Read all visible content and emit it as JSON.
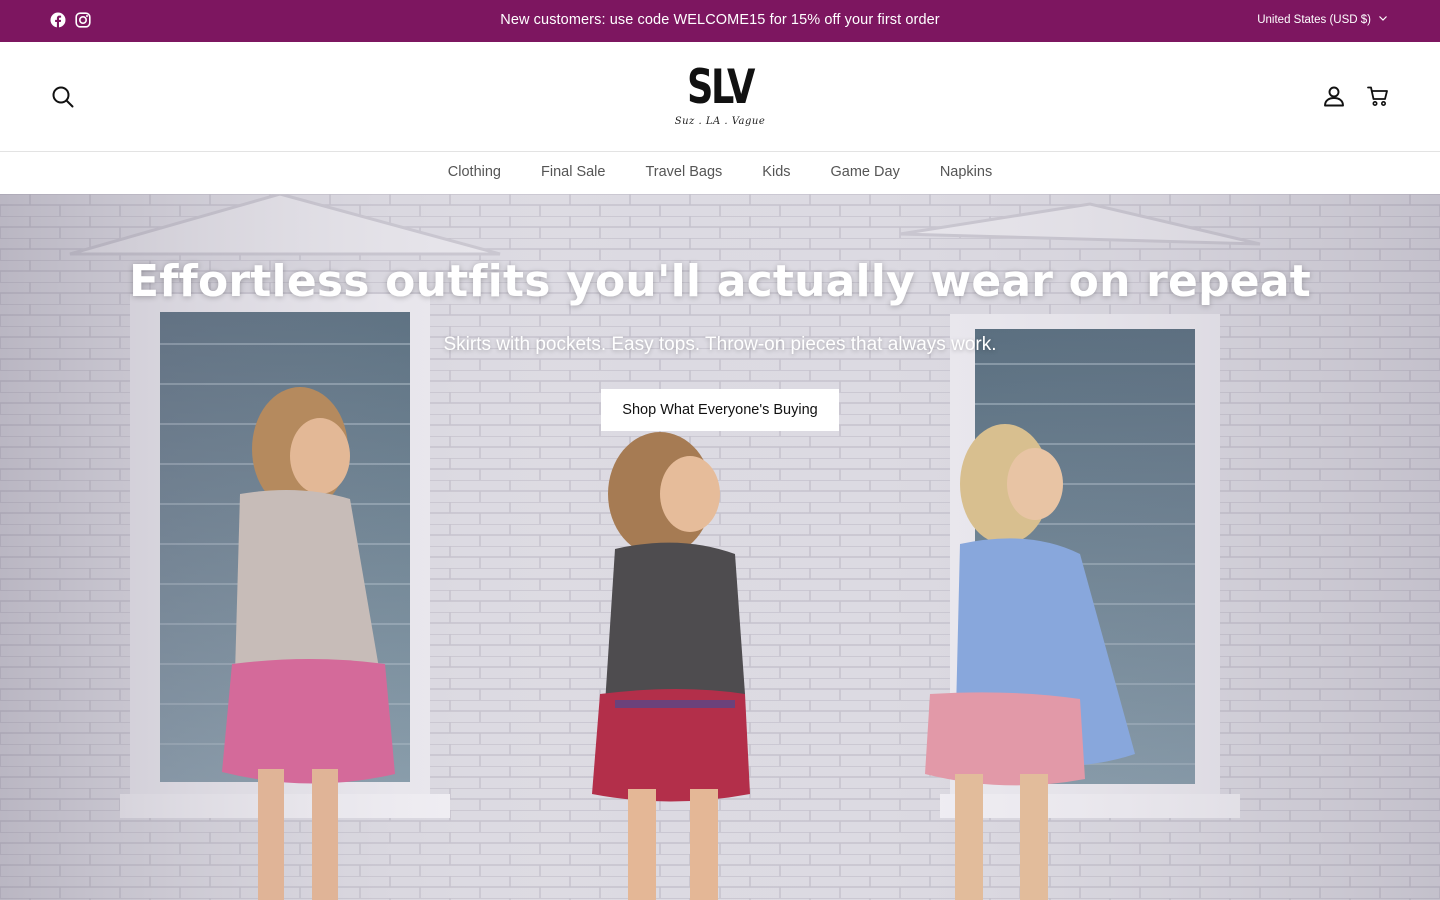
{
  "announcement": {
    "message": "New customers: use code WELCOME15 for 15% off your first order",
    "locale": "United States (USD $)",
    "social": [
      "facebook-icon",
      "instagram-icon"
    ],
    "background": "#7d1660"
  },
  "header": {
    "logo_mark": "SLV",
    "logo_tagline": "Suz . LA . Vague",
    "icons": [
      "search-icon",
      "account-icon",
      "cart-icon"
    ]
  },
  "nav": {
    "items": [
      "Clothing",
      "Final Sale",
      "Travel Bags",
      "Kids",
      "Game Day",
      "Napkins"
    ]
  },
  "hero": {
    "title": "Effortless outfits you'll actually wear on repeat",
    "subtitle": "Skirts with pockets. Easy tops. Throw-on pieces that always work.",
    "cta_label": "Shop What Everyone's Buying"
  }
}
